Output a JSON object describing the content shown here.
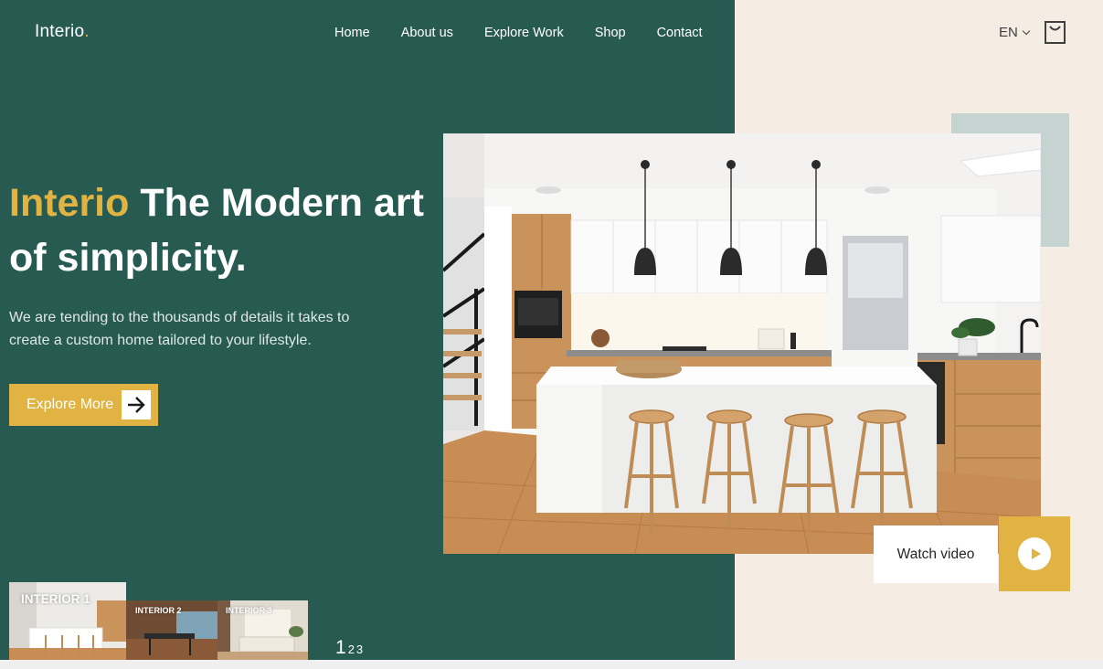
{
  "brand": {
    "name": "Interio",
    "dot": "."
  },
  "nav": {
    "items": [
      "Home",
      "About us",
      "Explore Work",
      "Shop",
      "Contact"
    ]
  },
  "header": {
    "language": "EN"
  },
  "hero": {
    "title_accent": "Interio",
    "title_rest": " The Modern art of simplicity.",
    "description": "We are tending to the thousands of details it takes to create a custom home tailored to your lifestyle.",
    "cta_label": "Explore More"
  },
  "video": {
    "label": "Watch video"
  },
  "thumbnails": [
    {
      "label": "INTERIOR 1"
    },
    {
      "label": "INTERIOR 2"
    },
    {
      "label": "INTERIOR 3"
    }
  ],
  "pagination": {
    "active": "1",
    "others": [
      "2",
      "3"
    ]
  },
  "colors": {
    "primary_green": "#275b52",
    "accent_gold": "#e0b343",
    "cream_background": "#f5ede3",
    "sage_square": "#c5d4d1"
  },
  "icons": {
    "cart": "shopping-bag-icon",
    "language_dropdown": "chevron-down-icon",
    "cta": "arrow-right-icon",
    "video": "play-icon"
  }
}
